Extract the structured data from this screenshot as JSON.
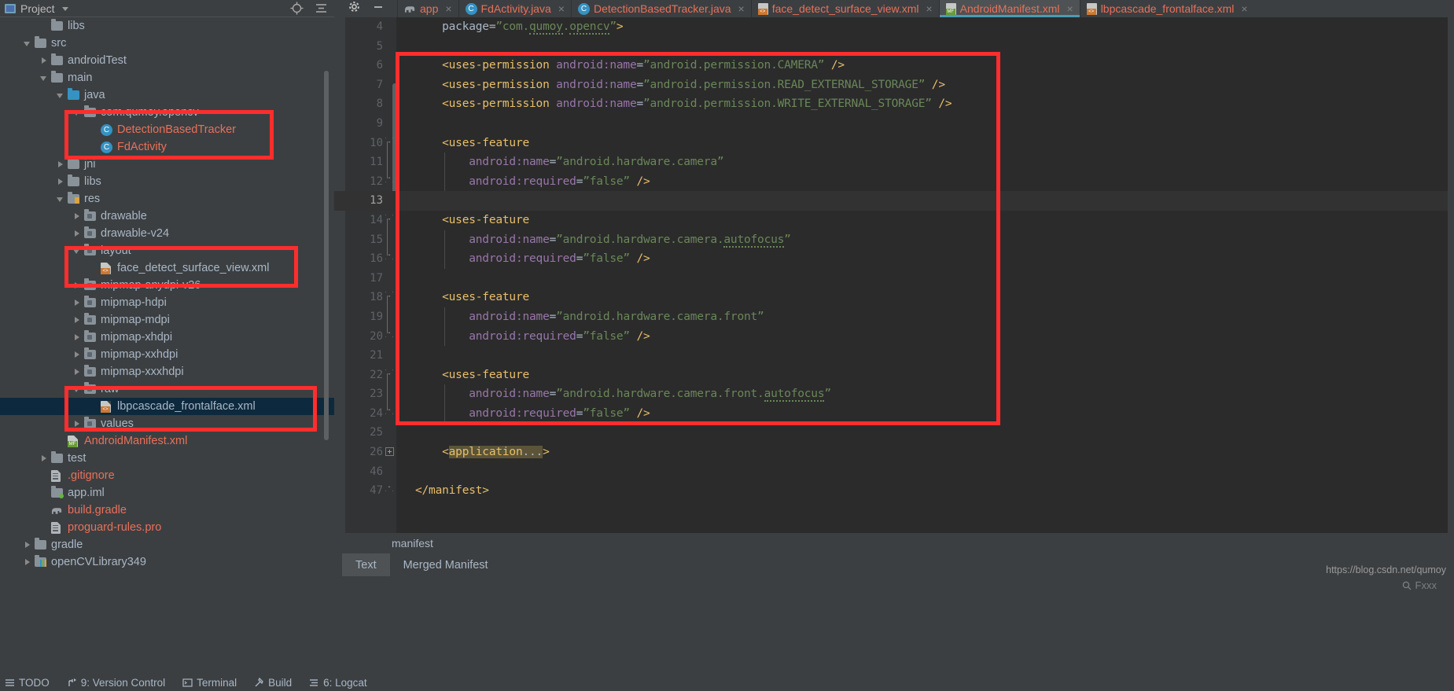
{
  "project_panel": {
    "title": "Project",
    "icons": [
      "target-icon",
      "collapse-all-icon",
      "settings-gear-icon",
      "minimize-icon"
    ],
    "tree": [
      {
        "label": "libs",
        "indent": 2,
        "arrow": "none",
        "icon": "folder",
        "color": "blue"
      },
      {
        "label": "src",
        "indent": 1,
        "arrow": "down",
        "icon": "folder",
        "color": "blue"
      },
      {
        "label": "androidTest",
        "indent": 2,
        "arrow": "right",
        "icon": "folder",
        "color": "blue"
      },
      {
        "label": "main",
        "indent": 2,
        "arrow": "down",
        "icon": "folder",
        "color": "blue"
      },
      {
        "label": "java",
        "indent": 3,
        "arrow": "down",
        "icon": "folder-blue",
        "color": "blue"
      },
      {
        "label": "com.qumoy.opencv",
        "indent": 4,
        "arrow": "down",
        "icon": "folder",
        "color": "blue"
      },
      {
        "label": "DetectionBasedTracker",
        "indent": 5,
        "arrow": "none",
        "icon": "class",
        "color": "salmon"
      },
      {
        "label": "FdActivity",
        "indent": 5,
        "arrow": "none",
        "icon": "class",
        "color": "salmon"
      },
      {
        "label": "jni",
        "indent": 3,
        "arrow": "right",
        "icon": "folder",
        "color": "blue"
      },
      {
        "label": "libs",
        "indent": 3,
        "arrow": "right",
        "icon": "folder",
        "color": "blue"
      },
      {
        "label": "res",
        "indent": 3,
        "arrow": "down",
        "icon": "folder-res",
        "color": "blue"
      },
      {
        "label": "drawable",
        "indent": 4,
        "arrow": "right",
        "icon": "folder-dr",
        "color": "blue"
      },
      {
        "label": "drawable-v24",
        "indent": 4,
        "arrow": "right",
        "icon": "folder-dr",
        "color": "blue"
      },
      {
        "label": "layout",
        "indent": 4,
        "arrow": "down",
        "icon": "folder-dr",
        "color": "blue"
      },
      {
        "label": "face_detect_surface_view.xml",
        "indent": 5,
        "arrow": "none",
        "icon": "xml",
        "color": "blue"
      },
      {
        "label": "mipmap-anydpi-v26",
        "indent": 4,
        "arrow": "right",
        "icon": "folder-dr",
        "color": "blue"
      },
      {
        "label": "mipmap-hdpi",
        "indent": 4,
        "arrow": "right",
        "icon": "folder-dr",
        "color": "blue"
      },
      {
        "label": "mipmap-mdpi",
        "indent": 4,
        "arrow": "right",
        "icon": "folder-dr",
        "color": "blue"
      },
      {
        "label": "mipmap-xhdpi",
        "indent": 4,
        "arrow": "right",
        "icon": "folder-dr",
        "color": "blue"
      },
      {
        "label": "mipmap-xxhdpi",
        "indent": 4,
        "arrow": "right",
        "icon": "folder-dr",
        "color": "blue"
      },
      {
        "label": "mipmap-xxxhdpi",
        "indent": 4,
        "arrow": "right",
        "icon": "folder-dr",
        "color": "blue"
      },
      {
        "label": "raw",
        "indent": 4,
        "arrow": "down",
        "icon": "folder-dr",
        "color": "blue"
      },
      {
        "label": "lbpcascade_frontalface.xml",
        "indent": 5,
        "arrow": "none",
        "icon": "xml",
        "color": "blue",
        "selected": true
      },
      {
        "label": "values",
        "indent": 4,
        "arrow": "right",
        "icon": "folder-dr",
        "color": "blue"
      },
      {
        "label": "AndroidManifest.xml",
        "indent": 3,
        "arrow": "none",
        "icon": "xml-mf",
        "color": "salmon"
      },
      {
        "label": "test",
        "indent": 2,
        "arrow": "right",
        "icon": "folder",
        "color": "blue"
      },
      {
        "label": ".gitignore",
        "indent": 2,
        "arrow": "none",
        "icon": "txt",
        "color": "salmon"
      },
      {
        "label": "app.iml",
        "indent": 2,
        "arrow": "none",
        "icon": "folder-dot",
        "color": "blue"
      },
      {
        "label": "build.gradle",
        "indent": 2,
        "arrow": "none",
        "icon": "gradle",
        "color": "salmon"
      },
      {
        "label": "proguard-rules.pro",
        "indent": 2,
        "arrow": "none",
        "icon": "txt",
        "color": "salmon"
      },
      {
        "label": "gradle",
        "indent": 1,
        "arrow": "right",
        "icon": "folder",
        "color": "blue"
      },
      {
        "label": "openCVLibrary349",
        "indent": 1,
        "arrow": "right",
        "icon": "folder-bars",
        "color": "blue"
      }
    ]
  },
  "editor": {
    "tabs": [
      {
        "label": "app",
        "icon": "gradle-icon",
        "active": false
      },
      {
        "label": "FdActivity.java",
        "icon": "class-icon",
        "active": false
      },
      {
        "label": "DetectionBasedTracker.java",
        "icon": "class-icon",
        "active": false
      },
      {
        "label": "face_detect_surface_view.xml",
        "icon": "xml-icon",
        "active": false
      },
      {
        "label": "AndroidManifest.xml",
        "icon": "manifest-icon",
        "active": true
      },
      {
        "label": "lbpcascade_frontalface.xml",
        "icon": "xml-icon",
        "active": false
      }
    ],
    "close_glyph": "×",
    "lines": [
      {
        "num": "4",
        "indent": 1,
        "fold": "none",
        "current": false,
        "tokens": [
          {
            "t": "plain",
            "v": "    package="
          },
          {
            "t": "val",
            "v": "”com."
          },
          {
            "t": "val-sq",
            "v": "qumoy"
          },
          {
            "t": "val",
            "v": "."
          },
          {
            "t": "val-sq",
            "v": "opencv"
          },
          {
            "t": "val",
            "v": "”"
          },
          {
            "t": "tag",
            "v": ">"
          }
        ]
      },
      {
        "num": "5",
        "indent": 1,
        "fold": "none",
        "current": false,
        "tokens": []
      },
      {
        "num": "6",
        "indent": 1,
        "fold": "none",
        "current": false,
        "tokens": [
          {
            "t": "tag",
            "v": "    <uses-permission "
          },
          {
            "t": "attr",
            "v": "android:name"
          },
          {
            "t": "eq",
            "v": "="
          },
          {
            "t": "val",
            "v": "”android.permission.CAMERA”"
          },
          {
            "t": "tag",
            "v": " />"
          }
        ]
      },
      {
        "num": "7",
        "indent": 1,
        "fold": "none",
        "current": false,
        "tokens": [
          {
            "t": "tag",
            "v": "    <uses-permission "
          },
          {
            "t": "attr",
            "v": "android:name"
          },
          {
            "t": "eq",
            "v": "="
          },
          {
            "t": "val",
            "v": "”android.permission.READ_EXTERNAL_STORAGE”"
          },
          {
            "t": "tag",
            "v": " />"
          }
        ]
      },
      {
        "num": "8",
        "indent": 1,
        "fold": "none",
        "current": false,
        "tokens": [
          {
            "t": "tag",
            "v": "    <uses-permission "
          },
          {
            "t": "attr",
            "v": "android:name"
          },
          {
            "t": "eq",
            "v": "="
          },
          {
            "t": "val",
            "v": "”android.permission.WRITE_EXTERNAL_STORAGE”"
          },
          {
            "t": "tag",
            "v": " />"
          }
        ]
      },
      {
        "num": "9",
        "indent": 1,
        "fold": "none",
        "current": false,
        "tokens": []
      },
      {
        "num": "10",
        "indent": 1,
        "fold": "open-start",
        "current": false,
        "tokens": [
          {
            "t": "tag",
            "v": "    <uses-feature"
          }
        ]
      },
      {
        "num": "11",
        "indent": 2,
        "fold": "none",
        "current": false,
        "tokens": [
          {
            "t": "attr",
            "v": "        android:name"
          },
          {
            "t": "eq",
            "v": "="
          },
          {
            "t": "val",
            "v": "”android.hardware.camera”"
          }
        ]
      },
      {
        "num": "12",
        "indent": 2,
        "fold": "open-end",
        "current": false,
        "tokens": [
          {
            "t": "attr",
            "v": "        android:required"
          },
          {
            "t": "eq",
            "v": "="
          },
          {
            "t": "val",
            "v": "”false”"
          },
          {
            "t": "tag",
            "v": " />"
          }
        ]
      },
      {
        "num": "13",
        "indent": 1,
        "fold": "none",
        "current": true,
        "tokens": []
      },
      {
        "num": "14",
        "indent": 1,
        "fold": "open-start",
        "current": false,
        "tokens": [
          {
            "t": "tag",
            "v": "    <uses-feature"
          }
        ]
      },
      {
        "num": "15",
        "indent": 2,
        "fold": "none",
        "current": false,
        "tokens": [
          {
            "t": "attr",
            "v": "        android:name"
          },
          {
            "t": "eq",
            "v": "="
          },
          {
            "t": "val",
            "v": "”android.hardware.camera."
          },
          {
            "t": "val-sq",
            "v": "autofocus"
          },
          {
            "t": "val",
            "v": "”"
          }
        ]
      },
      {
        "num": "16",
        "indent": 2,
        "fold": "open-end",
        "current": false,
        "tokens": [
          {
            "t": "attr",
            "v": "        android:required"
          },
          {
            "t": "eq",
            "v": "="
          },
          {
            "t": "val",
            "v": "”false”"
          },
          {
            "t": "tag",
            "v": " />"
          }
        ]
      },
      {
        "num": "17",
        "indent": 1,
        "fold": "none",
        "current": false,
        "tokens": []
      },
      {
        "num": "18",
        "indent": 1,
        "fold": "open-start",
        "current": false,
        "tokens": [
          {
            "t": "tag",
            "v": "    <uses-feature"
          }
        ]
      },
      {
        "num": "19",
        "indent": 2,
        "fold": "none",
        "current": false,
        "tokens": [
          {
            "t": "attr",
            "v": "        android:name"
          },
          {
            "t": "eq",
            "v": "="
          },
          {
            "t": "val",
            "v": "”android.hardware.camera.front”"
          }
        ]
      },
      {
        "num": "20",
        "indent": 2,
        "fold": "open-end",
        "current": false,
        "tokens": [
          {
            "t": "attr",
            "v": "        android:required"
          },
          {
            "t": "eq",
            "v": "="
          },
          {
            "t": "val",
            "v": "”false”"
          },
          {
            "t": "tag",
            "v": " />"
          }
        ]
      },
      {
        "num": "21",
        "indent": 1,
        "fold": "none",
        "current": false,
        "tokens": []
      },
      {
        "num": "22",
        "indent": 1,
        "fold": "open-start",
        "current": false,
        "tokens": [
          {
            "t": "tag",
            "v": "    <uses-feature"
          }
        ]
      },
      {
        "num": "23",
        "indent": 2,
        "fold": "none",
        "current": false,
        "tokens": [
          {
            "t": "attr",
            "v": "        android:name"
          },
          {
            "t": "eq",
            "v": "="
          },
          {
            "t": "val",
            "v": "”android.hardware.camera.front."
          },
          {
            "t": "val-sq",
            "v": "autofocus"
          },
          {
            "t": "val",
            "v": "”"
          }
        ]
      },
      {
        "num": "24",
        "indent": 2,
        "fold": "open-end",
        "current": false,
        "tokens": [
          {
            "t": "attr",
            "v": "        android:required"
          },
          {
            "t": "eq",
            "v": "="
          },
          {
            "t": "val",
            "v": "”false”"
          },
          {
            "t": "tag",
            "v": " />"
          }
        ]
      },
      {
        "num": "25",
        "indent": 1,
        "fold": "none",
        "current": false,
        "tokens": []
      },
      {
        "num": "26",
        "indent": 1,
        "fold": "collapsed",
        "current": false,
        "tokens": [
          {
            "t": "tag",
            "v": "    <"
          },
          {
            "t": "tag-hl",
            "v": "application"
          },
          {
            "t": "plain-hl",
            "v": "..."
          },
          {
            "t": "tag",
            "v": ">"
          }
        ]
      },
      {
        "num": "46",
        "indent": 1,
        "fold": "none",
        "current": false,
        "tokens": []
      },
      {
        "num": "47",
        "indent": 0,
        "fold": "open-end",
        "current": false,
        "tokens": [
          {
            "t": "tag",
            "v": "</manifest>"
          }
        ]
      }
    ],
    "breadcrumb": "manifest",
    "bottom_tabs": [
      {
        "label": "Text",
        "active": true
      },
      {
        "label": "Merged Manifest",
        "active": false
      }
    ]
  },
  "watermark": {
    "url": "https://blog.csdn.net/qumoy",
    "secondary": "Fxxx"
  },
  "statusbar": {
    "items": [
      {
        "label": "TODO",
        "icon": "list-icon"
      },
      {
        "label": "9: Version Control",
        "icon": "branch-icon"
      },
      {
        "label": "Terminal",
        "icon": "terminal-icon"
      },
      {
        "label": "Build",
        "icon": "hammer-icon"
      },
      {
        "label": "6: Logcat",
        "icon": "logcat-icon"
      }
    ]
  },
  "colors": {
    "accent": "#4a9bb5",
    "annotation": "#ff2d2d",
    "selection": "#0d293e",
    "editor_bg": "#2b2b2b",
    "panel_bg": "#3c3f41",
    "tag": "#e8bf6a",
    "attr": "#9876aa",
    "value": "#6a8759",
    "filename": "#e8705a"
  }
}
